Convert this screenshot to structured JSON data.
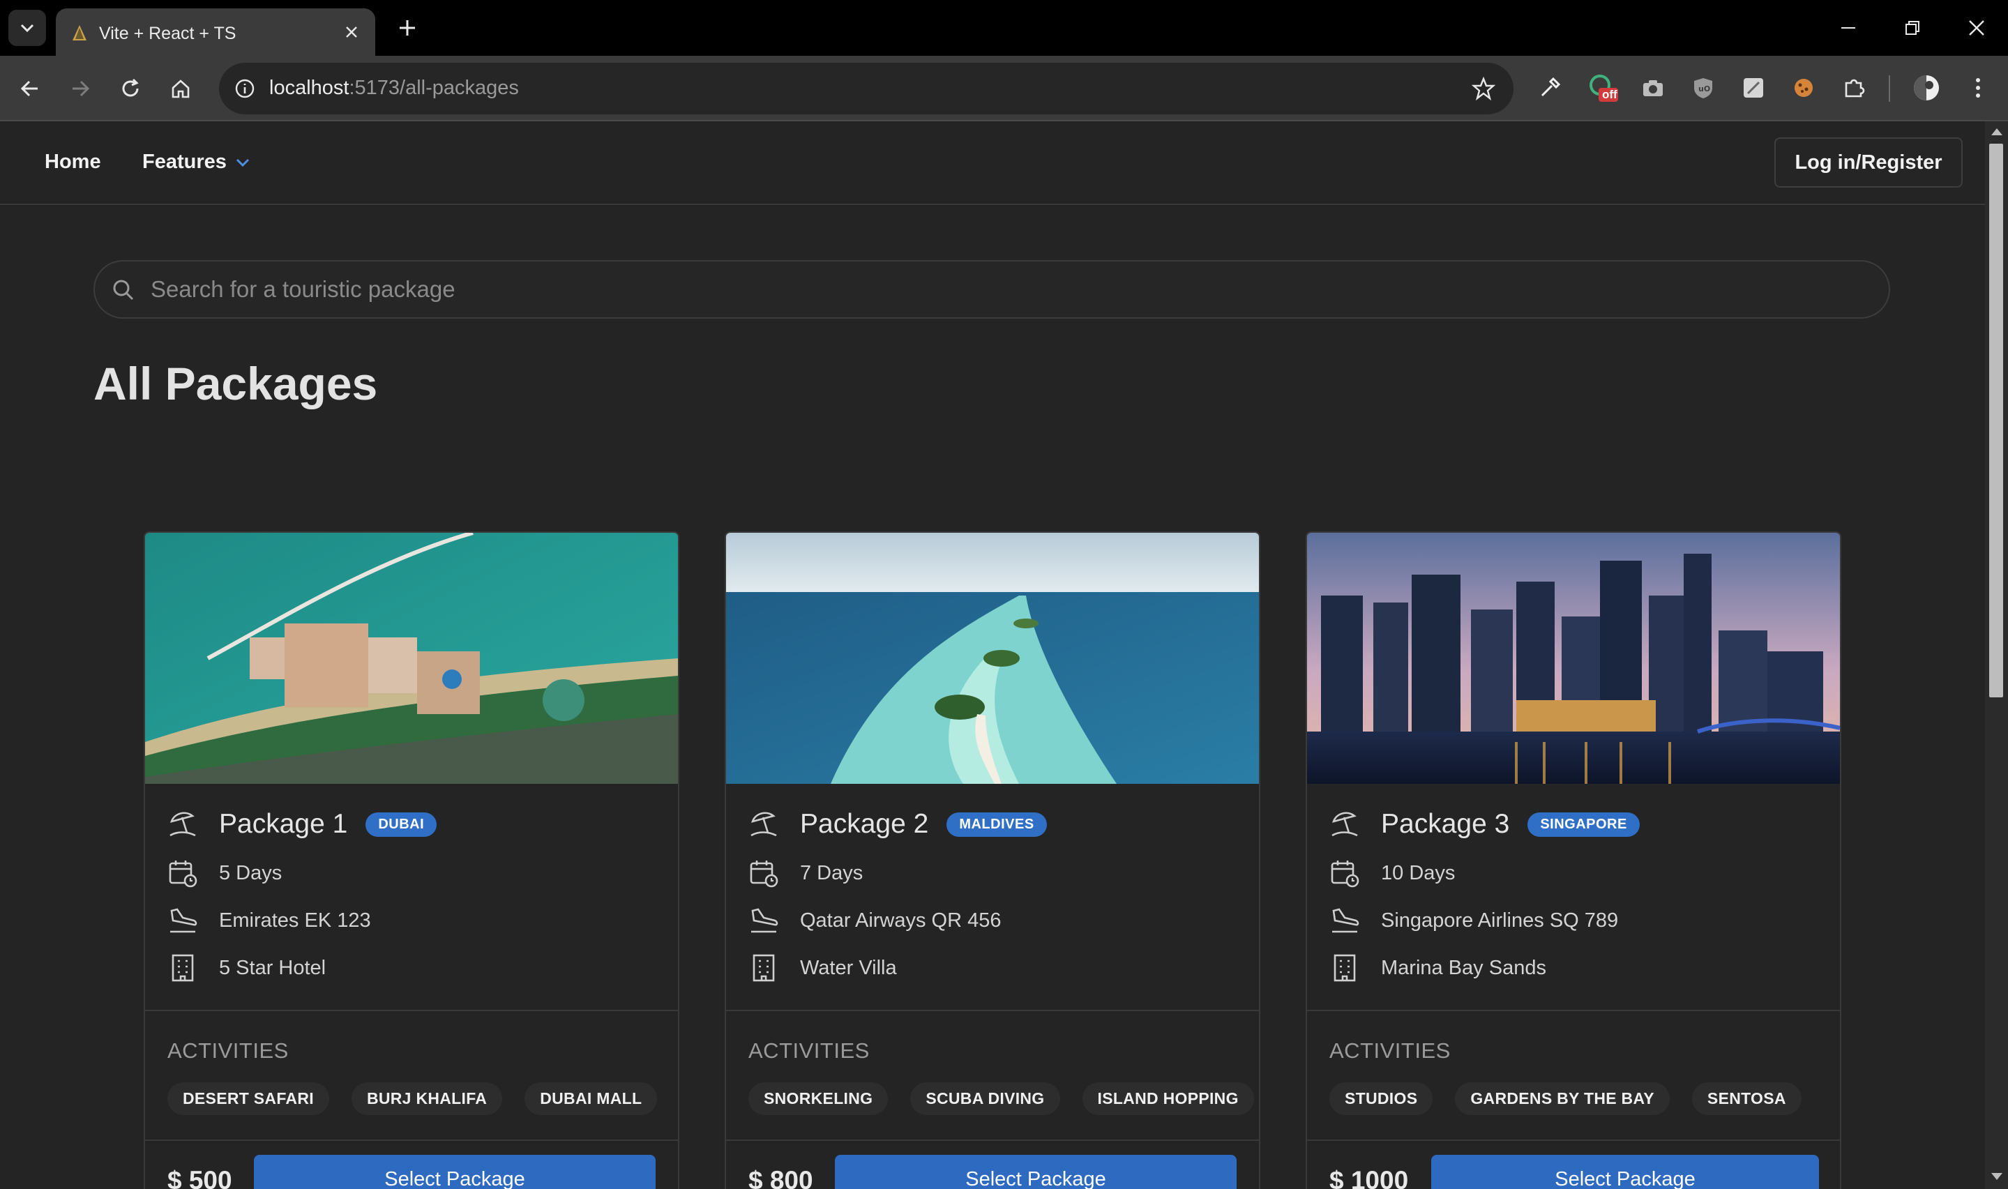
{
  "browser": {
    "tab_title": "Vite + React + TS",
    "url_host": "localhost",
    "url_path": ":5173/all-packages",
    "extension_badge": "off"
  },
  "nav": {
    "home": "Home",
    "features": "Features",
    "login": "Log in/Register"
  },
  "search": {
    "placeholder": "Search for a touristic package"
  },
  "page_title": "All Packages",
  "activities_title": "ACTIVITIES",
  "select_label": "Select Package",
  "packages": [
    {
      "name": "Package 1",
      "destination": "DUBAI",
      "duration": "5 Days",
      "flight": "Emirates EK 123",
      "hotel": "5 Star Hotel",
      "activities": [
        "DESERT SAFARI",
        "BURJ KHALIFA",
        "DUBAI MALL"
      ],
      "price": "$ 500"
    },
    {
      "name": "Package 2",
      "destination": "MALDIVES",
      "duration": "7 Days",
      "flight": "Qatar Airways QR 456",
      "hotel": "Water Villa",
      "activities": [
        "SNORKELING",
        "SCUBA DIVING",
        "ISLAND HOPPING"
      ],
      "price": "$ 800"
    },
    {
      "name": "Package 3",
      "destination": "SINGAPORE",
      "duration": "10 Days",
      "flight": "Singapore Airlines SQ 789",
      "hotel": "Marina Bay Sands",
      "activities": [
        "STUDIOS",
        "GARDENS BY THE BAY",
        "SENTOSA"
      ],
      "price": "$ 1000"
    }
  ],
  "colors": {
    "accent": "#2f6fc6",
    "background": "#242424",
    "badge": "#2f6fc6"
  }
}
